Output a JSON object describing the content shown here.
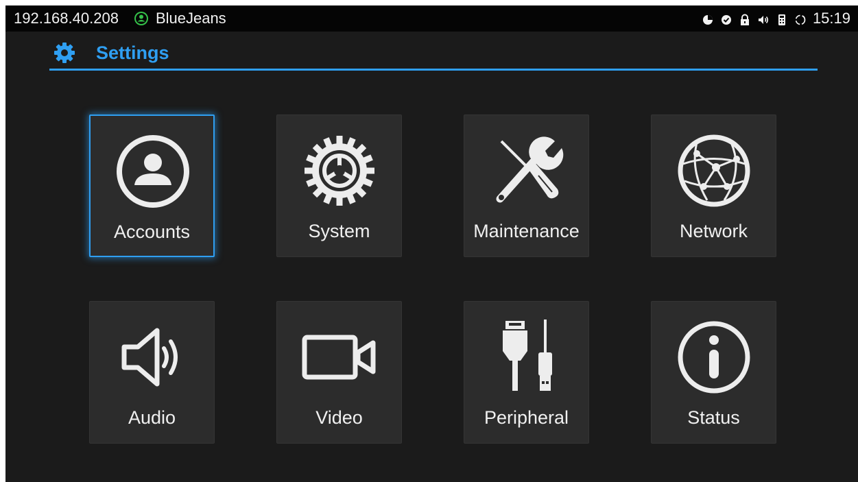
{
  "statusbar": {
    "ip": "192.168.40.208",
    "account_name": "BlueJeans",
    "time": "15:19",
    "icons": [
      "pie-icon",
      "shield-check-icon",
      "lock-icon",
      "volume-icon",
      "remote-icon",
      "sync-icon"
    ],
    "account_icon_color": "#35c24a"
  },
  "header": {
    "title": "Settings",
    "accent": "#2f9ff2"
  },
  "tiles": [
    {
      "label": "Accounts",
      "icon": "account-icon",
      "focused": true
    },
    {
      "label": "System",
      "icon": "gear-icon"
    },
    {
      "label": "Maintenance",
      "icon": "tools-icon"
    },
    {
      "label": "Network",
      "icon": "globe-icon"
    },
    {
      "label": "Audio",
      "icon": "speaker-icon"
    },
    {
      "label": "Video",
      "icon": "video-camera-icon"
    },
    {
      "label": "Peripheral",
      "icon": "connector-icon"
    },
    {
      "label": "Status",
      "icon": "info-icon"
    }
  ]
}
